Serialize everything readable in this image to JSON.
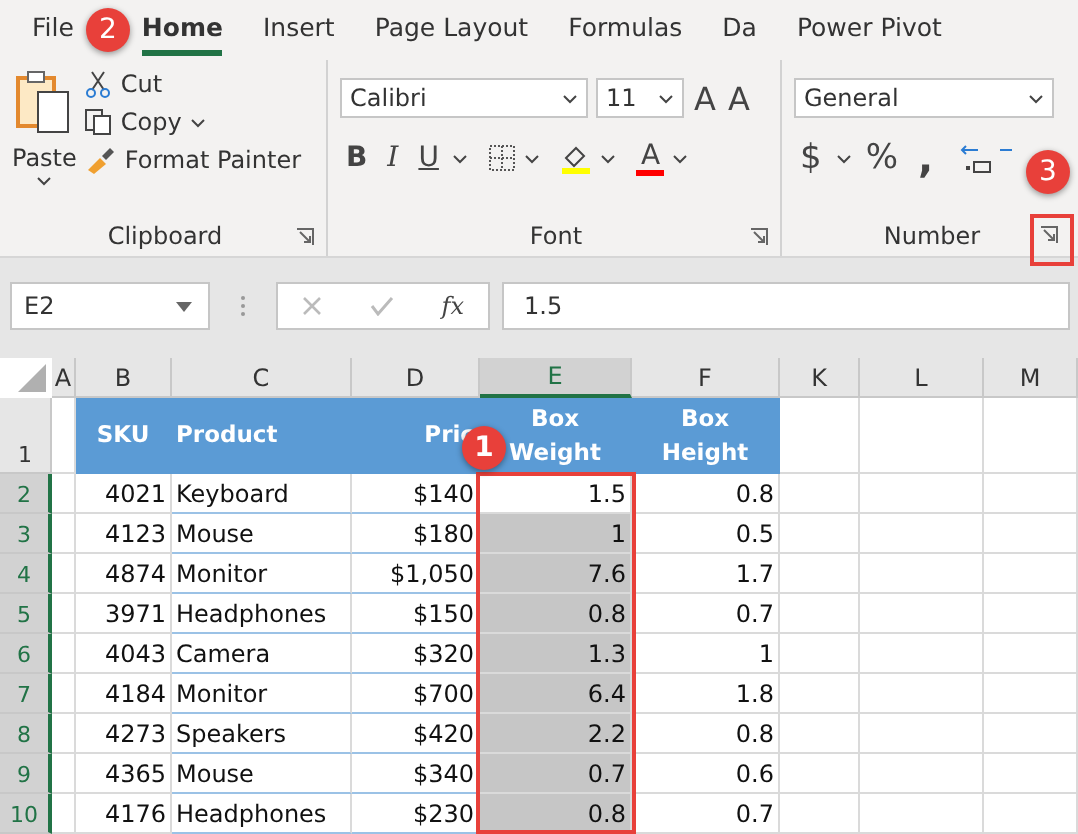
{
  "tabs": [
    {
      "label": "File",
      "selected": false
    },
    {
      "label": "Home",
      "selected": true
    },
    {
      "label": "Insert",
      "selected": false
    },
    {
      "label": "Page Layout",
      "selected": false
    },
    {
      "label": "Formulas",
      "selected": false
    },
    {
      "label": "Da",
      "selected": false
    },
    {
      "label": "Power Pivot",
      "selected": false
    }
  ],
  "step_badges": [
    "1",
    "2",
    "3"
  ],
  "clipboard": {
    "paste": "Paste",
    "items": [
      "Cut",
      "Copy",
      "Format Painter"
    ],
    "label": "Clipboard"
  },
  "font": {
    "name": "Calibri",
    "size": "11",
    "size_buttons": [
      "A",
      "A"
    ],
    "style_buttons": [
      "B",
      "I",
      "U"
    ],
    "color_buttons": [
      {
        "glyph": "A",
        "color": "#ff0000"
      }
    ],
    "label": "Font"
  },
  "number": {
    "format": "General",
    "buttons": [
      "$",
      "%",
      ","
    ],
    "label": "Number"
  },
  "formula_bar": {
    "name_box": "E2",
    "fx": "fx",
    "value": "1.5"
  },
  "columns": [
    {
      "letter": "A",
      "selected": false
    },
    {
      "letter": "B",
      "selected": false
    },
    {
      "letter": "C",
      "selected": false
    },
    {
      "letter": "D",
      "selected": false
    },
    {
      "letter": "E",
      "selected": true
    },
    {
      "letter": "F",
      "selected": false
    },
    {
      "letter": "K",
      "selected": false
    },
    {
      "letter": "L",
      "selected": false
    },
    {
      "letter": "M",
      "selected": false
    }
  ],
  "header_row": {
    "number": "1",
    "cells": [
      "SKU",
      "Product",
      "Pric",
      "Box Weight",
      "Box Height"
    ]
  },
  "rows": [
    {
      "number": "2",
      "selected": true,
      "active": true,
      "cells": [
        "4021",
        "Keyboard",
        "$140",
        "1.5",
        "0.8"
      ]
    },
    {
      "number": "3",
      "selected": true,
      "active": false,
      "cells": [
        "4123",
        "Mouse",
        "$180",
        "1",
        "0.5"
      ]
    },
    {
      "number": "4",
      "selected": true,
      "active": false,
      "cells": [
        "4874",
        "Monitor",
        "$1,050",
        "7.6",
        "1.7"
      ]
    },
    {
      "number": "5",
      "selected": true,
      "active": false,
      "cells": [
        "3971",
        "Headphones",
        "$150",
        "0.8",
        "0.7"
      ]
    },
    {
      "number": "6",
      "selected": true,
      "active": false,
      "cells": [
        "4043",
        "Camera",
        "$320",
        "1.3",
        "1"
      ]
    },
    {
      "number": "7",
      "selected": true,
      "active": false,
      "cells": [
        "4184",
        "Monitor",
        "$700",
        "6.4",
        "1.8"
      ]
    },
    {
      "number": "8",
      "selected": true,
      "active": false,
      "cells": [
        "4273",
        "Speakers",
        "$420",
        "2.2",
        "0.8"
      ]
    },
    {
      "number": "9",
      "selected": true,
      "active": false,
      "cells": [
        "4365",
        "Mouse",
        "$340",
        "0.7",
        "0.6"
      ]
    },
    {
      "number": "10",
      "selected": true,
      "active": false,
      "cells": [
        "4176",
        "Headphones",
        "$230",
        "0.8",
        "0.7"
      ]
    }
  ]
}
